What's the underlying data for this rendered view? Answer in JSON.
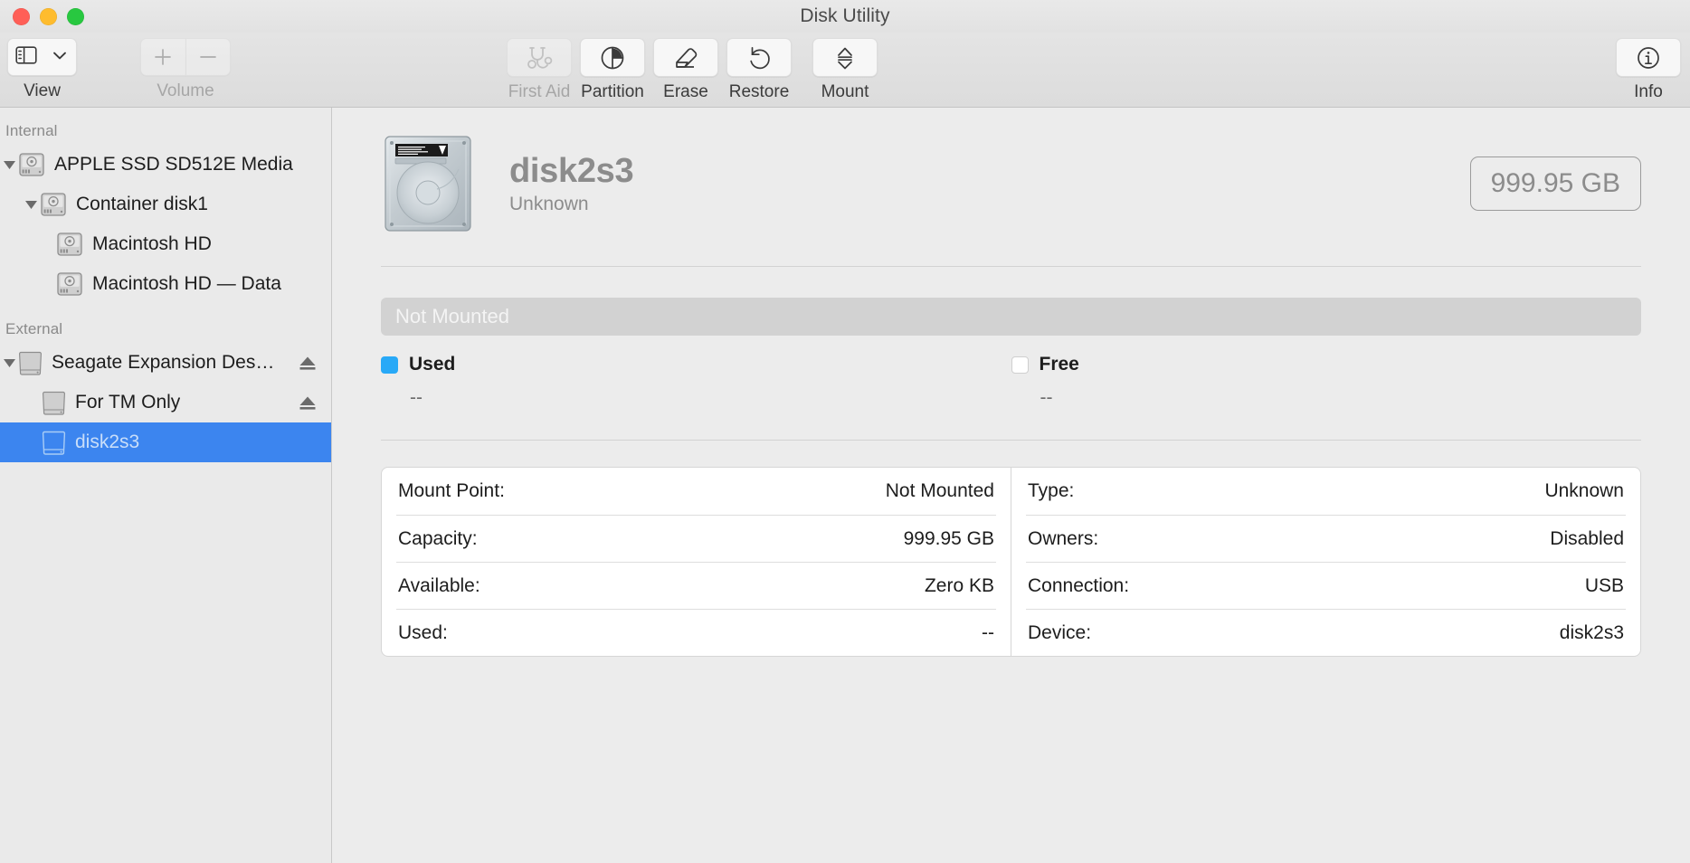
{
  "window": {
    "title": "Disk Utility",
    "traffic_lights": [
      "close",
      "minimize",
      "zoom"
    ]
  },
  "toolbar": {
    "view": {
      "label": "View",
      "icon": "sidebar-icon",
      "chevron": "chevron-down-icon"
    },
    "volume": {
      "label": "Volume",
      "add": "+",
      "remove": "−"
    },
    "items": [
      {
        "label": "First Aid",
        "icon": "stethoscope-icon",
        "disabled": true
      },
      {
        "label": "Partition",
        "icon": "pie-chart-icon",
        "disabled": false
      },
      {
        "label": "Erase",
        "icon": "eraser-icon",
        "disabled": false
      },
      {
        "label": "Restore",
        "icon": "undo-arrow-icon",
        "disabled": false
      },
      {
        "label": "Mount",
        "icon": "eject-icon",
        "disabled": false
      }
    ],
    "info": {
      "label": "Info",
      "icon": "info-circle-icon"
    }
  },
  "sidebar": {
    "sections": [
      {
        "header": "Internal",
        "rows": [
          {
            "label": "APPLE SSD SD512E Media",
            "indent": 0,
            "twisty": "down",
            "icon": "internal-disk-icon",
            "eject": false,
            "selected": false
          },
          {
            "label": "Container disk1",
            "indent": 1,
            "twisty": "down",
            "icon": "internal-disk-icon",
            "eject": false,
            "selected": false
          },
          {
            "label": "Macintosh HD",
            "indent": 2,
            "twisty": "none",
            "icon": "internal-disk-icon",
            "eject": false,
            "selected": false
          },
          {
            "label": "Macintosh HD — Data",
            "indent": 2,
            "twisty": "none",
            "icon": "internal-disk-icon",
            "eject": false,
            "selected": false
          }
        ]
      },
      {
        "header": "External",
        "rows": [
          {
            "label": "Seagate Expansion Des…",
            "indent": 0,
            "twisty": "down",
            "icon": "external-disk-icon",
            "eject": true,
            "selected": false
          },
          {
            "label": "For TM Only",
            "indent": 1,
            "twisty": "none",
            "icon": "external-disk-icon",
            "eject": true,
            "selected": false
          },
          {
            "label": "disk2s3",
            "indent": 1,
            "twisty": "none",
            "icon": "external-disk-icon",
            "eject": false,
            "selected": true
          }
        ]
      }
    ]
  },
  "main": {
    "hero": {
      "icon": "hard-drive-photo-icon",
      "title": "disk2s3",
      "subtitle": "Unknown",
      "capacity_badge": "999.95 GB"
    },
    "usage": {
      "bar_label": "Not Mounted",
      "legend": [
        {
          "name": "Used",
          "value": "--",
          "color": "#28a9f7"
        },
        {
          "name": "Free",
          "value": "--",
          "color": "#ffffff"
        }
      ]
    },
    "details": {
      "left": [
        {
          "label": "Mount Point:",
          "value": "Not Mounted"
        },
        {
          "label": "Capacity:",
          "value": "999.95 GB"
        },
        {
          "label": "Available:",
          "value": "Zero KB"
        },
        {
          "label": "Used:",
          "value": "--"
        }
      ],
      "right": [
        {
          "label": "Type:",
          "value": "Unknown"
        },
        {
          "label": "Owners:",
          "value": "Disabled"
        },
        {
          "label": "Connection:",
          "value": "USB"
        },
        {
          "label": "Device:",
          "value": "disk2s3"
        }
      ]
    }
  },
  "colors": {
    "selection_blue": "#3c85ef",
    "used_blue": "#28a9f7",
    "window_bg": "#ececec",
    "sidebar_bg": "#eaeaea"
  }
}
